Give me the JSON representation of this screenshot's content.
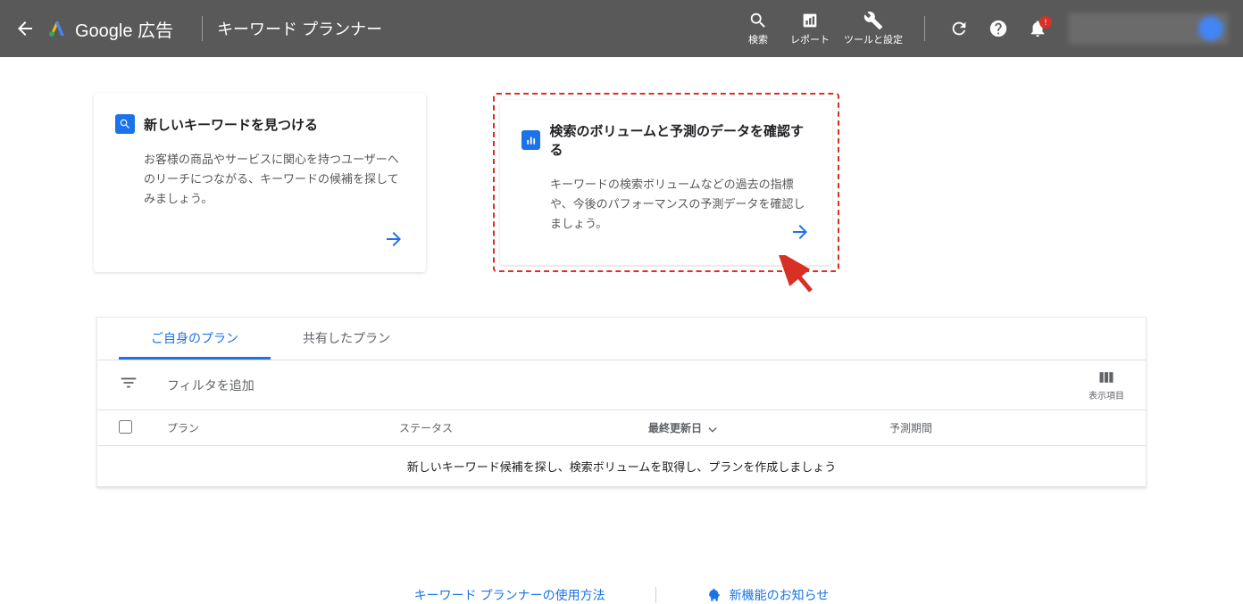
{
  "header": {
    "logo_text": "Google 広告",
    "tool_title": "キーワード プランナー",
    "nav": {
      "search_label": "検索",
      "reports_label": "レポート",
      "tools_label": "ツールと設定"
    }
  },
  "cards": [
    {
      "title": "新しいキーワードを見つける",
      "desc": "お客様の商品やサービスに関心を持つユーザーへのリーチにつながる、キーワードの候補を探してみましょう。"
    },
    {
      "title": "検索のボリュームと予測のデータを確認する",
      "desc": "キーワードの検索ボリュームなどの過去の指標や、今後のパフォーマンスの予測データを確認しましょう。"
    }
  ],
  "plans": {
    "tabs": {
      "own": "ご自身のプラン",
      "shared": "共有したプラン"
    },
    "filter_label": "フィルタを追加",
    "columns_label": "表示項目",
    "columns": {
      "plan": "プラン",
      "status": "ステータス",
      "updated": "最終更新日",
      "forecast": "予測期間"
    },
    "empty_message": "新しいキーワード候補を探し、検索ボリュームを取得し、プランを作成しましょう"
  },
  "footer": {
    "guide": "キーワード プランナーの使用方法",
    "changelog": "新機能のお知らせ"
  },
  "notif_badge": "!"
}
